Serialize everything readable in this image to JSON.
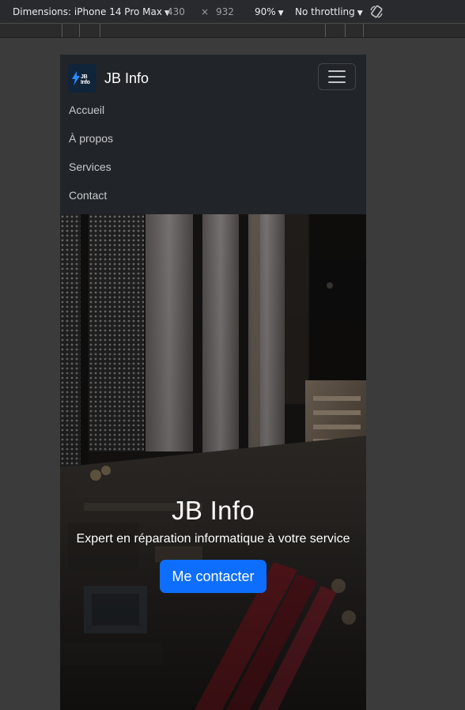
{
  "devtools": {
    "dimensions_label": "Dimensions: iPhone 14 Pro Max",
    "width": "430",
    "times": "×",
    "height": "932",
    "zoom": "90%",
    "throttling": "No throttling",
    "caret": "▼"
  },
  "navbar": {
    "logo_text": "JB Info",
    "brand": "JB Info",
    "links": [
      "Accueil",
      "À propos",
      "Services",
      "Contact"
    ]
  },
  "hero": {
    "title": "JB Info",
    "subtitle": "Expert en réparation informatique à votre service",
    "button": "Me contacter"
  },
  "colors": {
    "navbar_bg": "#212529",
    "primary": "#0d6efd"
  }
}
